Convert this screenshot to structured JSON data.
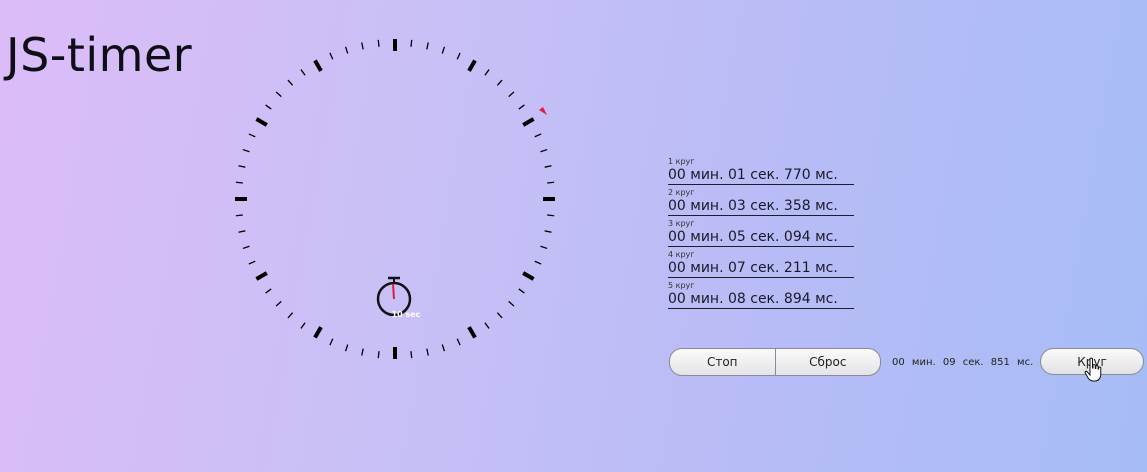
{
  "app": {
    "title": "JS-timer"
  },
  "dial": {
    "stopwatch_label": "10 sec",
    "tick_count": 60,
    "marker_color": "#e0203a",
    "hand_color": "#e0203a"
  },
  "laps": [
    {
      "label": "1 круг",
      "time": "00 мин. 01 сек. 770 мс."
    },
    {
      "label": "2 круг",
      "time": "00 мин. 03 сек. 358 мс."
    },
    {
      "label": "3 круг",
      "time": "00 мин. 05 сек. 094 мс."
    },
    {
      "label": "4 круг",
      "time": "00 мин. 07 сек. 211 мс."
    },
    {
      "label": "5 круг",
      "time": "00 мин. 08 сек. 894 мс."
    }
  ],
  "controls": {
    "stop_label": "Стоп",
    "reset_label": "Сброс",
    "current_time": "00 мин. 09 сек. 851 мс.",
    "lap_label": "Круг"
  },
  "cursor": {
    "icon": "hand-pointer-icon"
  }
}
